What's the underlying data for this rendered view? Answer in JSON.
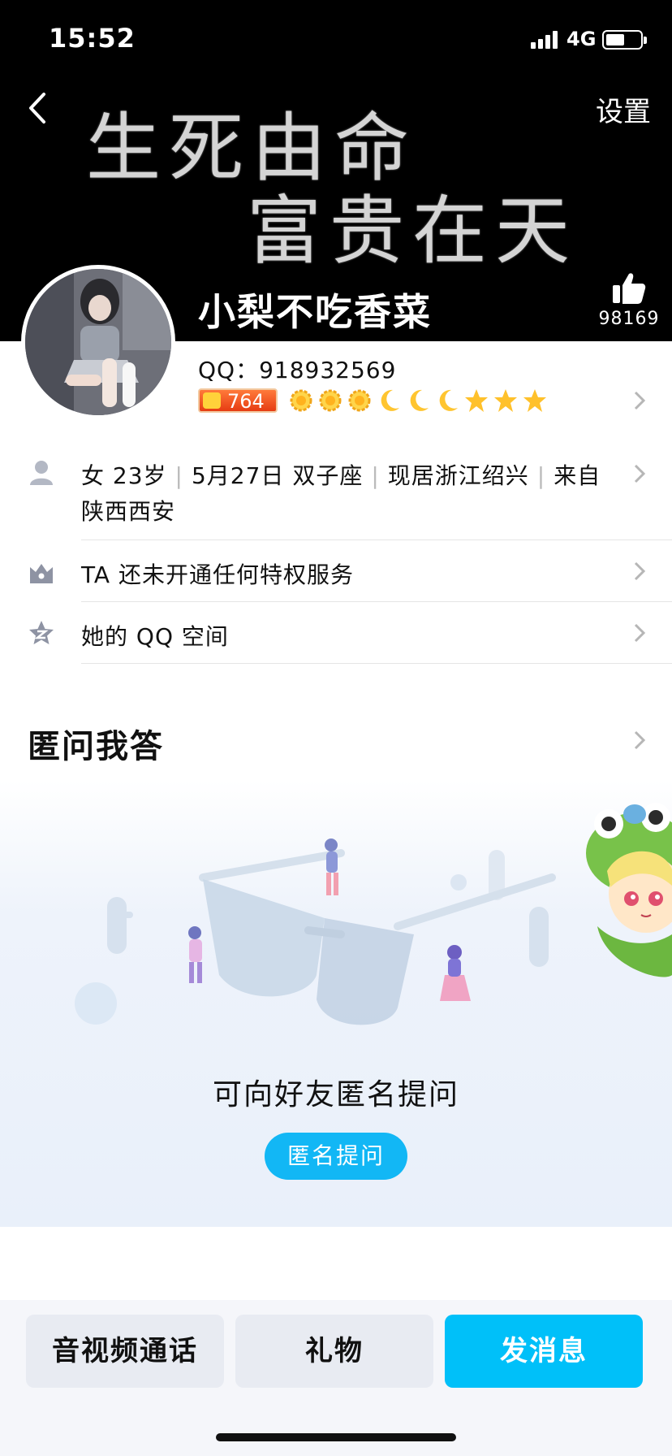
{
  "status_bar": {
    "time": "15:52",
    "network": "4G"
  },
  "header": {
    "settings_label": "设置",
    "cover_lines": [
      "生死由命",
      "富贵在天"
    ],
    "nickname": "小梨不吃香菜",
    "like_count": "98169"
  },
  "profile": {
    "qq_label": "QQ：",
    "qq_number": "918932569",
    "level_badge": "764",
    "level_icons": [
      "sun",
      "sun",
      "sun",
      "moon",
      "moon",
      "moon",
      "star",
      "star",
      "star"
    ]
  },
  "info_rows": {
    "basic_parts": [
      "女 23岁",
      "5月27日 双子座",
      "现居浙江绍兴",
      "来自"
    ],
    "basic_line2": "陕西西安",
    "privilege": "TA 还未开通任何特权服务",
    "qzone": "她的 QQ 空间"
  },
  "qa_section": {
    "title": "匿问我答",
    "prompt": "可向好友匿名提问",
    "button": "匿名提问"
  },
  "bottom_bar": {
    "call_button": "音视频通话",
    "gift_button": "礼物",
    "message_button": "发消息"
  },
  "colors": {
    "accent": "#00c0f9",
    "cover_bg": "#000000",
    "badge": "#e63c13"
  }
}
